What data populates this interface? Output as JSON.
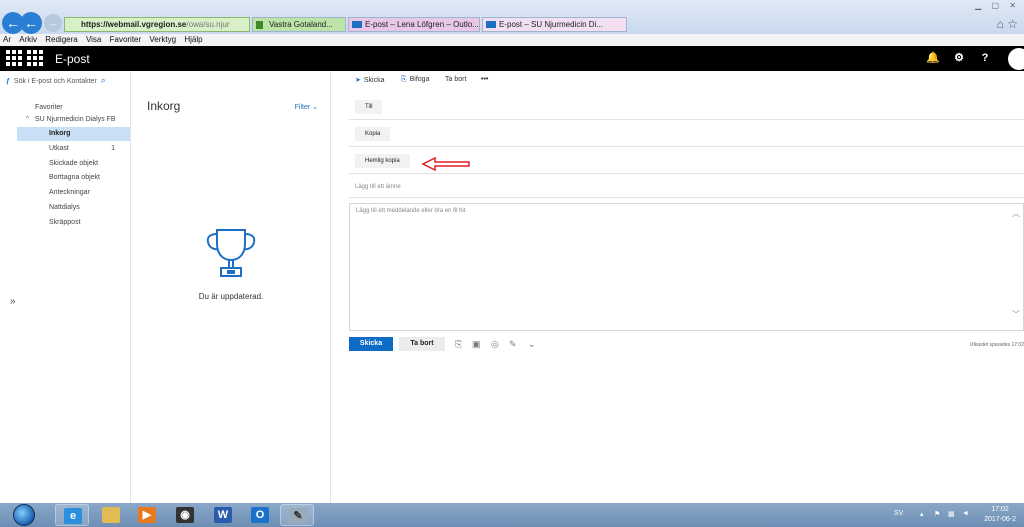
{
  "browser": {
    "address_url_domain": "https://webmail.vgregion.se",
    "address_url_rest": "/owa/su.njur",
    "tab_green_label": "Vastra Gotaland...",
    "tab_pink_label": "E-post – Lena Löfgren – Outlo...",
    "tab_active_label": "E-post – SU Njurmedicin Di...",
    "menu": [
      "Ar",
      "Arkiv",
      "Redigera",
      "Visa",
      "Favoriter",
      "Verktyg",
      "Hjälp"
    ]
  },
  "app": {
    "title": "E-post"
  },
  "left": {
    "search_placeholder": "Sök i E-post och Kontakter",
    "favorites_label": "Favoriter",
    "group_label": "SU Njurmedicin Dialys FB",
    "folders": [
      {
        "label": "Inkorg",
        "count": "",
        "selected": true
      },
      {
        "label": "Utkast",
        "count": "1",
        "selected": false
      },
      {
        "label": "Skickade objekt",
        "count": "",
        "selected": false
      },
      {
        "label": "Borttagna objekt",
        "count": "",
        "selected": false
      },
      {
        "label": "Anteckningar",
        "count": "",
        "selected": false
      },
      {
        "label": "Nattdialys",
        "count": "",
        "selected": false
      },
      {
        "label": "Skräppost",
        "count": "",
        "selected": false
      }
    ],
    "expand_label": "»"
  },
  "list": {
    "title": "Inkorg",
    "filter_label": "Filter",
    "empty_message": "Du är uppdaterad."
  },
  "compose": {
    "send_cmd": "Skicka",
    "attach_cmd": "Bifoga",
    "discard_cmd": "Ta bort",
    "more_cmd": "•••",
    "to_label": "Till",
    "cc_label": "Kopia",
    "bcc_label": "Hemlig kopia",
    "subject_placeholder": "Lägg till ett ämne",
    "body_placeholder": "Lägg till ett meddelande eller dra en fil hit",
    "send_button": "Skicka",
    "discard_button": "Ta bort",
    "saved_status": "Utkastet sparades 17:02"
  },
  "taskbar": {
    "language": "SV",
    "time": "17:02",
    "date": "2017-06-2"
  },
  "colors": {
    "accent": "#0f6cc6",
    "selected_folder": "#c8dff5",
    "annotation_arrow": "#e02020"
  }
}
